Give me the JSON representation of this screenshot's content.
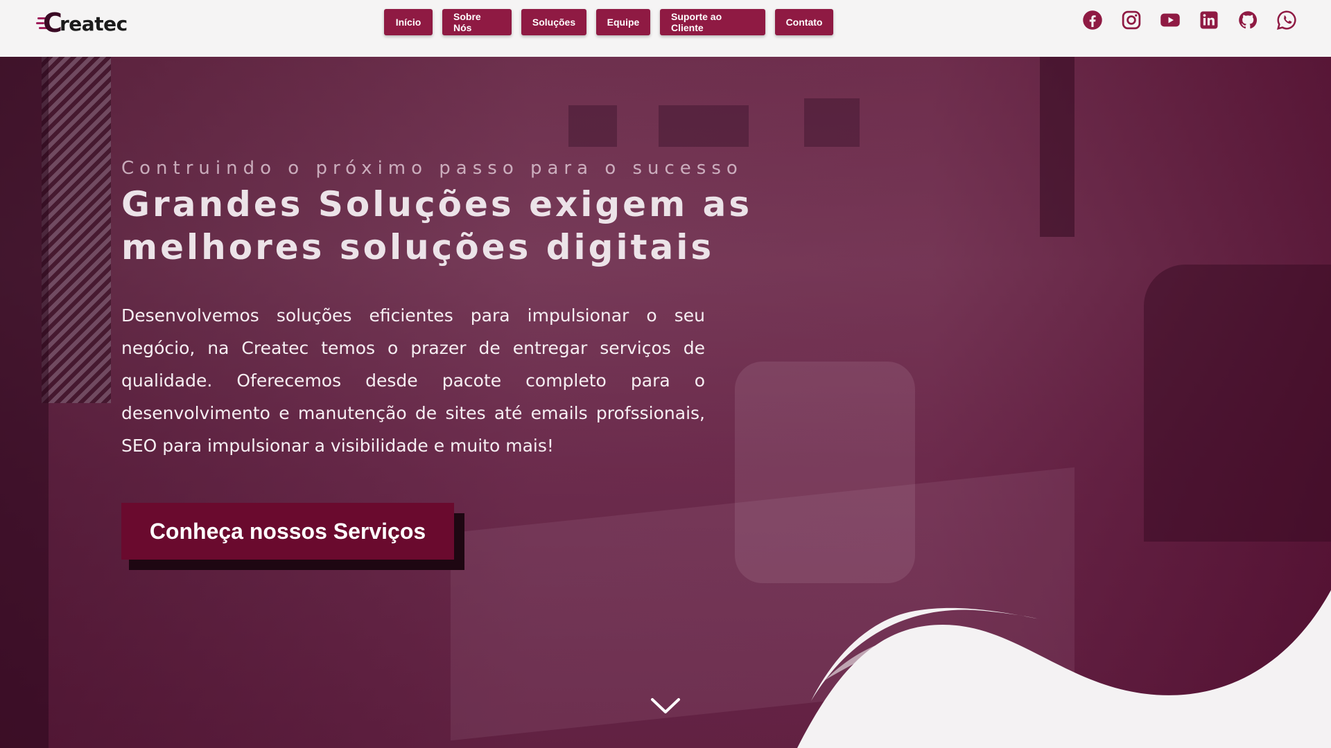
{
  "brand": {
    "logo_text": "reatec",
    "accent": "#8f1a43"
  },
  "nav": {
    "items": [
      {
        "label": "Início"
      },
      {
        "label": "Sobre Nós"
      },
      {
        "label": "Soluções"
      },
      {
        "label": "Equipe"
      },
      {
        "label": "Suporte ao Cliente"
      },
      {
        "label": "Contato"
      }
    ]
  },
  "social": {
    "icons": [
      "facebook-icon",
      "instagram-icon",
      "youtube-icon",
      "linkedin-icon",
      "github-icon",
      "whatsapp-icon"
    ],
    "color": "#8f1a43"
  },
  "hero": {
    "eyebrow": "Contruindo o próximo passo para o sucesso",
    "headline": "Grandes Soluções exigem as melhores soluções digitais",
    "description": "Desenvolvemos soluções eficientes para impulsionar o seu negócio, na Createc temos o prazer de entregar serviços de qualidade.  Oferecemos desde pacote completo para o desenvolvimento e manutenção de sites até emails profssionais, SEO para impulsionar a visibilidade e muito mais!",
    "cta_label": "Conheça nossos Serviços",
    "scroll_icon": "chevron-down-icon"
  }
}
